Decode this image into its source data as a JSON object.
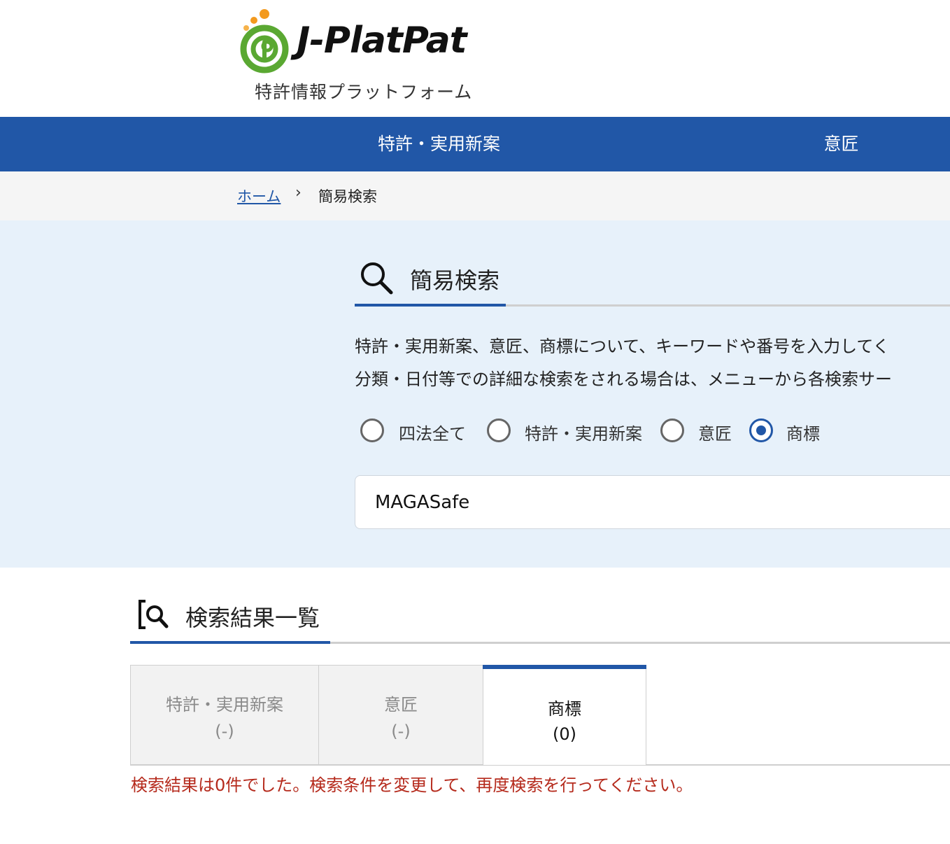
{
  "header": {
    "logo_word": "J-PlatPat",
    "logo_subtitle": "特許情報プラットフォーム"
  },
  "nav": {
    "items": [
      {
        "label": "特許・実用新案"
      },
      {
        "label": "意匠"
      }
    ]
  },
  "breadcrumb": {
    "home": "ホーム",
    "separator": "›",
    "current": "簡易検索"
  },
  "search": {
    "title": "簡易検索",
    "description_line1": "特許・実用新案、意匠、商標について、キーワードや番号を入力してく",
    "description_line2": "分類・日付等での詳細な検索をされる場合は、メニューから各検索サー",
    "options": [
      {
        "label": "四法全て",
        "checked": false
      },
      {
        "label": "特許・実用新案",
        "checked": false
      },
      {
        "label": "意匠",
        "checked": false
      },
      {
        "label": "商標",
        "checked": true
      }
    ],
    "query": "MAGASafe"
  },
  "results": {
    "title": "検索結果一覧",
    "tabs": [
      {
        "label": "特許・実用新案",
        "count": "(-)",
        "active": false
      },
      {
        "label": "意匠",
        "count": "(-)",
        "active": false
      },
      {
        "label": "商標",
        "count": "(0)",
        "active": true
      }
    ],
    "message": "検索結果は0件でした。検索条件を変更して、再度検索を行ってください。"
  },
  "colors": {
    "primary": "#2157a7",
    "panel_bg": "#e7f1fa",
    "error": "#b52a1c",
    "logo_green": "#5aa832",
    "logo_orange": "#f39a1e"
  }
}
